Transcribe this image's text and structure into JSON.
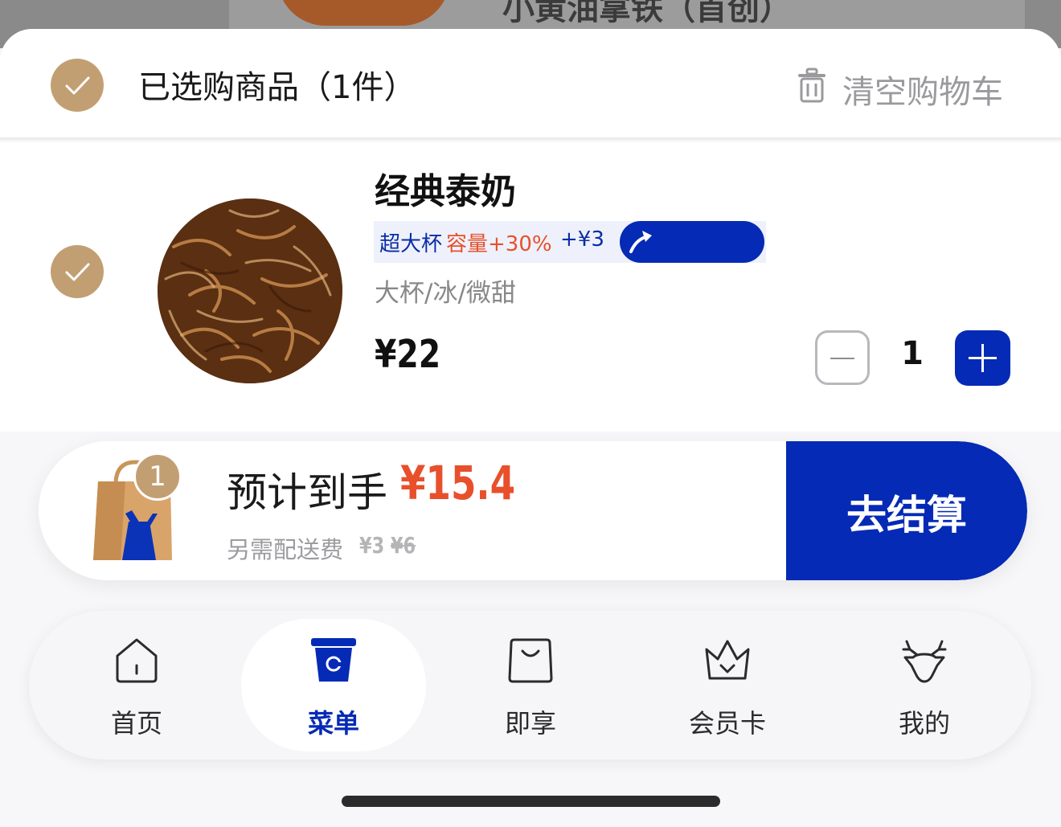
{
  "background_title": "小黄油拿铁（首创）",
  "cart": {
    "header_title": "已选购商品（1件）",
    "clear_label": "清空购物车"
  },
  "item": {
    "name": "经典泰奶",
    "promo_size": "超大杯",
    "promo_capacity": "容量+30%",
    "promo_price": "+¥3",
    "spec": "大杯/冰/微甜",
    "price": "¥22",
    "quantity": "1"
  },
  "checkout": {
    "bag_count": "1",
    "estimate_label": "预计到手",
    "estimate_value": "¥15.4",
    "fee_label": "另需配送费",
    "fee_value": "¥3",
    "fee_original": "¥6",
    "pay_label": "去结算"
  },
  "tabs": [
    {
      "label": "首页",
      "icon": "home-icon"
    },
    {
      "label": "菜单",
      "icon": "cup-icon"
    },
    {
      "label": "即享",
      "icon": "bag-icon"
    },
    {
      "label": "会员卡",
      "icon": "crown-icon"
    },
    {
      "label": "我的",
      "icon": "deer-icon"
    }
  ],
  "colors": {
    "brand_blue": "#052ab5",
    "accent_orange": "#e8502c",
    "check_gold": "#c29f73"
  }
}
